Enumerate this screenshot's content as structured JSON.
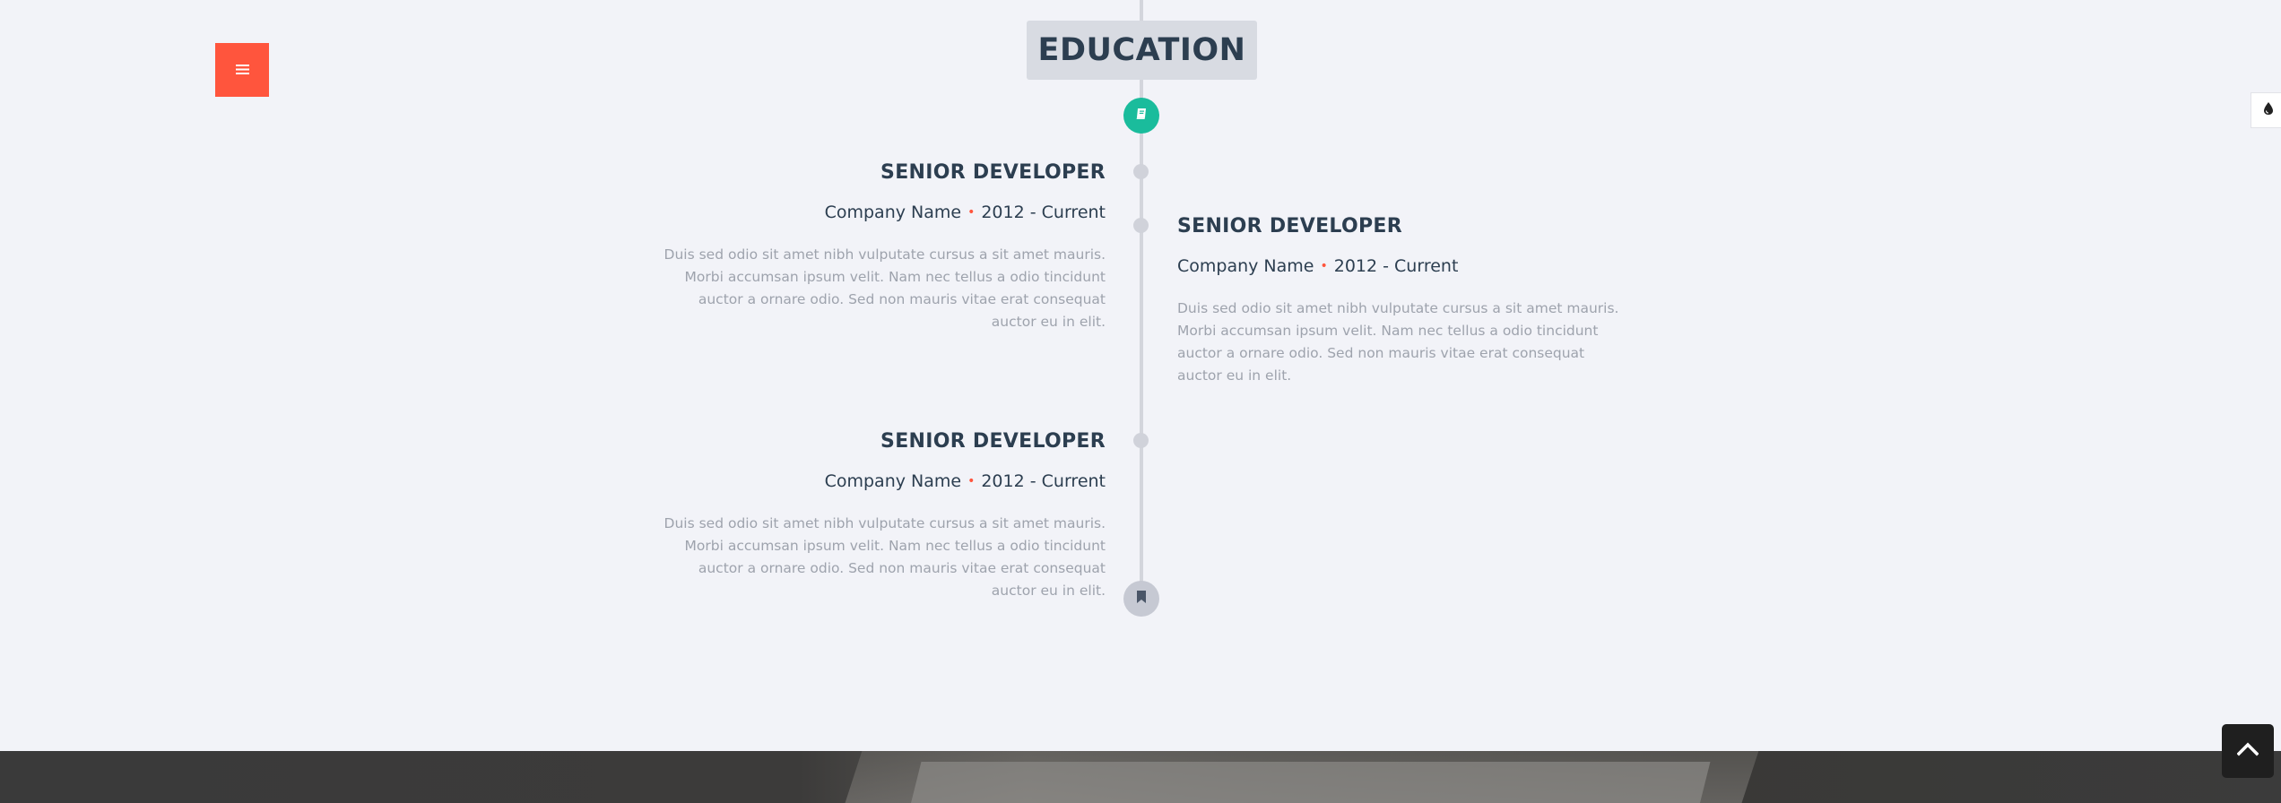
{
  "section": {
    "title": "EDUCATION"
  },
  "entries": [
    {
      "title": "SENIOR DEVELOPER",
      "company": "Company Name",
      "period": "2012 - Current",
      "description": "Duis sed odio sit amet nibh vulputate cursus a sit amet mauris. Morbi accumsan ipsum velit. Nam nec tellus a odio tincidunt auctor a ornare odio. Sed non mauris vitae erat consequat auctor eu in elit."
    },
    {
      "title": "SENIOR DEVELOPER",
      "company": "Company Name",
      "period": "2012 - Current",
      "description": "Duis sed odio sit amet nibh vulputate cursus a sit amet mauris. Morbi accumsan ipsum velit. Nam nec tellus a odio tincidunt auctor a ornare odio. Sed non mauris vitae erat consequat auctor eu in elit."
    },
    {
      "title": "SENIOR DEVELOPER",
      "company": "Company Name",
      "period": "2012 - Current",
      "description": "Duis sed odio sit amet nibh vulputate cursus a sit amet mauris. Morbi accumsan ipsum velit. Nam nec tellus a odio tincidunt auctor a ornare odio. Sed non mauris vitae erat consequat auctor eu in elit."
    }
  ],
  "separator": "•",
  "icons": {
    "menu": "hamburger-icon",
    "start": "book-icon",
    "end": "bookmark-icon",
    "theme": "ink-drop-icon",
    "scroll_top": "chevron-up-icon"
  },
  "colors": {
    "accent": "#ff553d",
    "teal": "#1abc9c",
    "background": "#f2f3f8",
    "heading": "#2c3e50",
    "muted_text": "#9ea3ad"
  }
}
